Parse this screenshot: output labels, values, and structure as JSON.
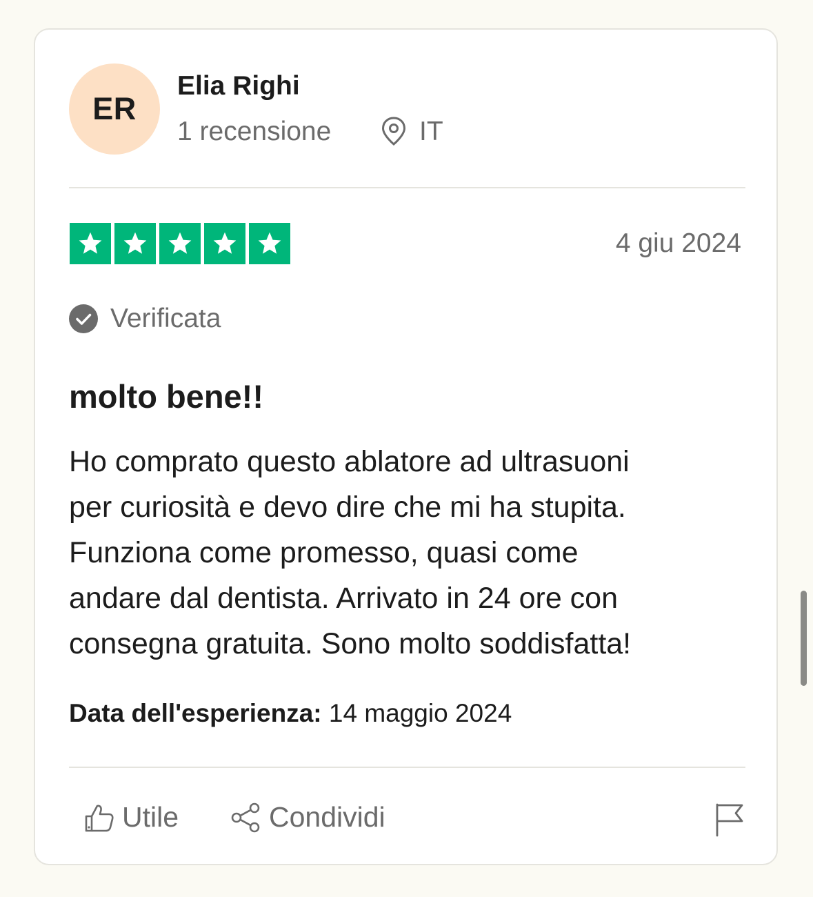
{
  "reviewer": {
    "initials": "ER",
    "name": "Elia Righi",
    "review_count": "1 recensione",
    "country": "IT"
  },
  "rating": {
    "stars": 5,
    "max_stars": 5,
    "star_color": "#00b67a"
  },
  "review": {
    "date": "4 giu 2024",
    "verified_label": "Verificata",
    "title": "molto bene!!",
    "body_lines": [
      "Ho comprato questo ablatore ad ultrasuoni",
      "per curiosità e devo dire che mi ha stupita.",
      "Funziona come promesso, quasi come",
      "andare dal dentista. Arrivato in 24 ore con",
      "consegna gratuita. Sono molto soddisfatta!"
    ],
    "experience_label": "Data dell'esperienza:",
    "experience_date": "14 maggio 2024"
  },
  "actions": {
    "useful_label": "Utile",
    "share_label": "Condividi"
  },
  "icons": {
    "location": "location-pin-icon",
    "verified": "check-circle-icon",
    "useful": "thumbs-up-icon",
    "share": "share-icon",
    "report": "flag-icon"
  },
  "colors": {
    "avatar_bg": "#fde0c5",
    "page_bg": "#fbfaf3",
    "muted_text": "#6b6b6b"
  }
}
